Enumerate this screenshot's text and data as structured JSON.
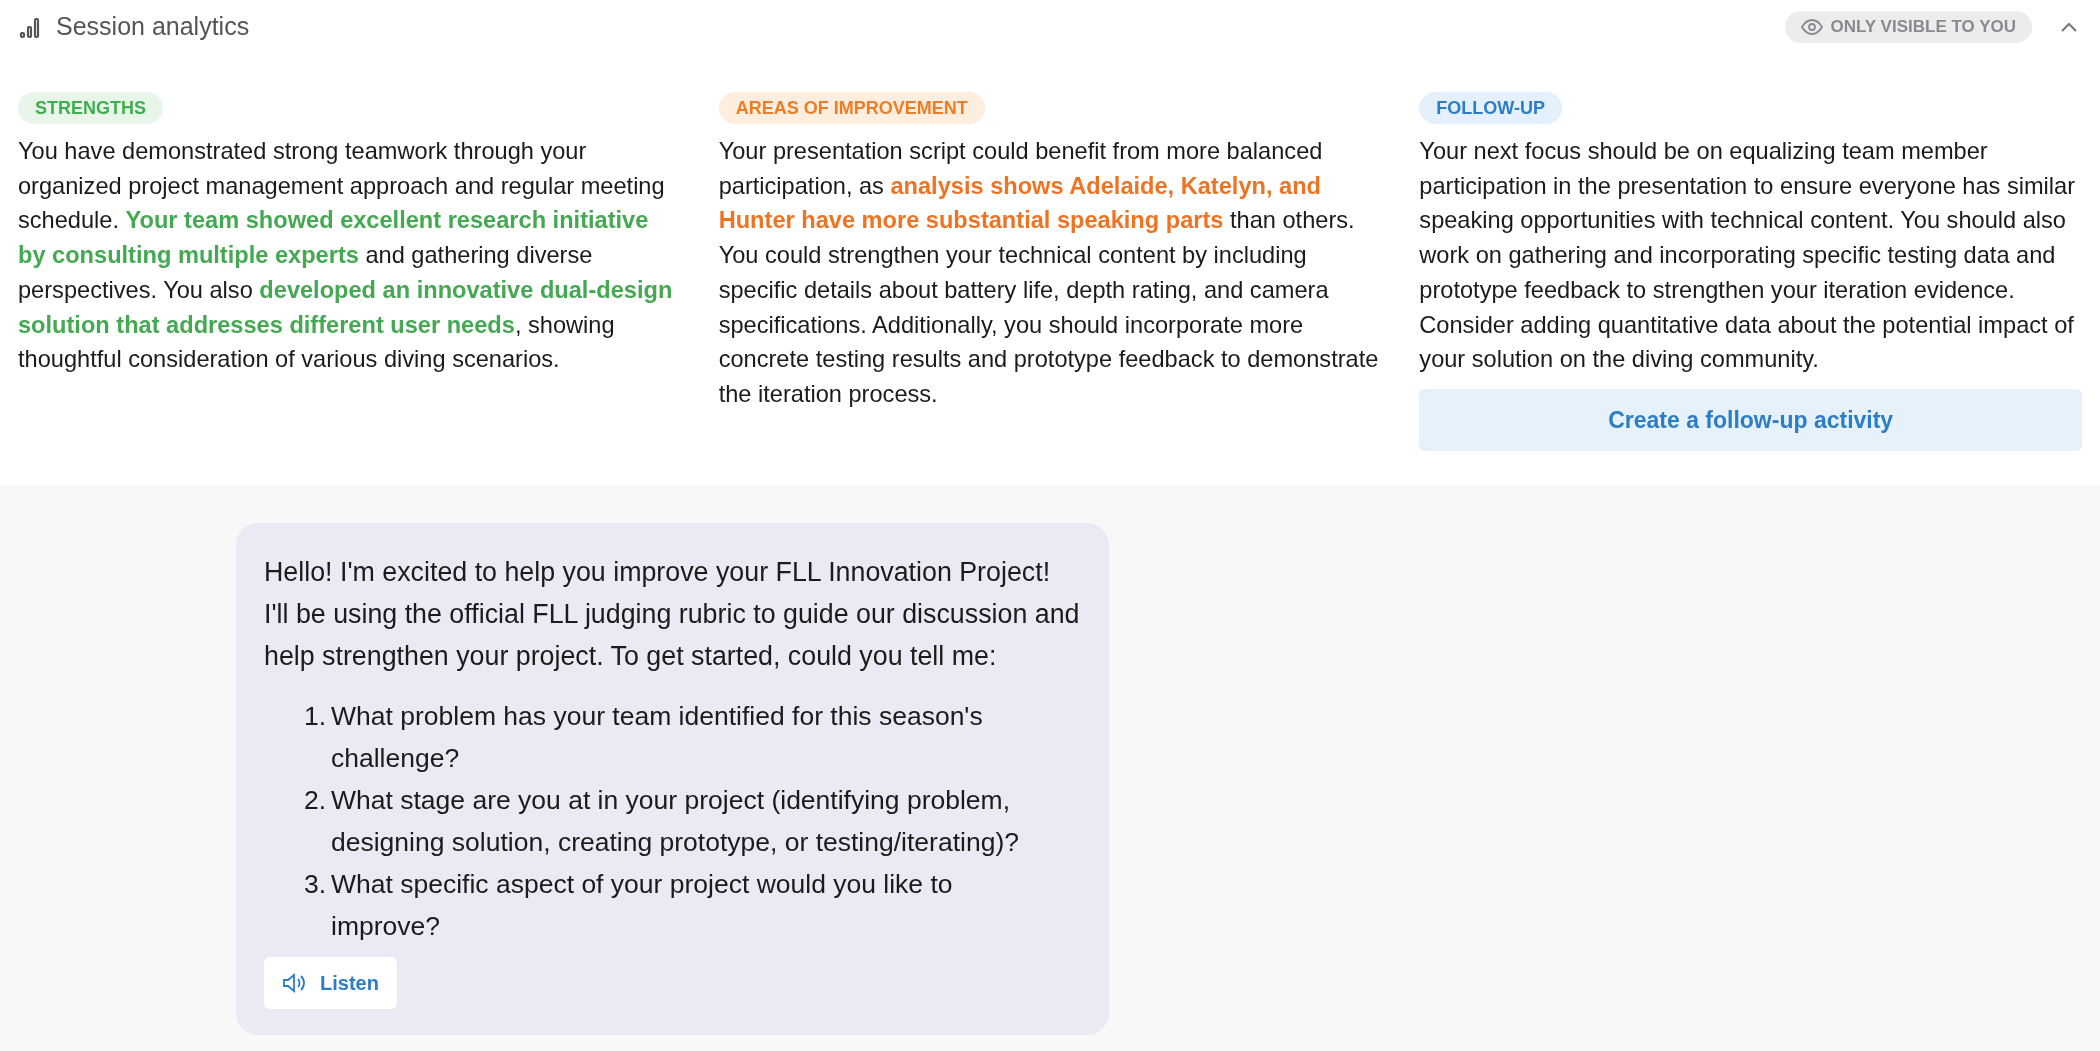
{
  "header": {
    "title": "Session analytics",
    "visibility": "ONLY VISIBLE TO YOU",
    "expanded": true
  },
  "columns": [
    {
      "kind": "strengths",
      "label": "STRENGTHS",
      "segments": [
        {
          "text": "You have demonstrated strong teamwork through your organized project management approach and regular meeting schedule. ",
          "highlight": false
        },
        {
          "text": "Your team showed excellent research initiative by consulting multiple experts",
          "highlight": true
        },
        {
          "text": " and gathering diverse perspectives. You also ",
          "highlight": false
        },
        {
          "text": "developed an innovative dual-design solution that addresses different user needs",
          "highlight": true
        },
        {
          "text": ", showing thoughtful consideration of various diving scenarios.",
          "highlight": false
        }
      ]
    },
    {
      "kind": "improvement",
      "label": "AREAS OF IMPROVEMENT",
      "segments": [
        {
          "text": "Your presentation script could benefit from more balanced participation, as ",
          "highlight": false
        },
        {
          "text": "analysis shows Adelaide, Katelyn, and Hunter have more substantial speaking parts",
          "highlight": true
        },
        {
          "text": " than others. You could strengthen your technical content by including specific details about battery life, depth rating, and camera specifications. Additionally, you should incorporate more concrete testing results and prototype feedback to demonstrate the iteration process.",
          "highlight": false
        }
      ]
    },
    {
      "kind": "followup",
      "label": "FOLLOW-UP",
      "segments": [
        {
          "text": "Your next focus should be on equalizing team member participation in the presentation to ensure everyone has similar speaking opportunities with technical content. You should also work on gathering and incorporating specific testing data and prototype feedback to strengthen your iteration evidence. Consider adding quantitative data about the potential impact of your solution on the diving community.",
          "highlight": false
        }
      ],
      "button": "Create a follow-up activity"
    }
  ],
  "message": {
    "intro": "Hello! I'm excited to help you improve your FLL Innovation Project! I'll be using the official FLL judging rubric to guide our discussion and help strengthen your project. To get started, could you tell me:",
    "questions": [
      {
        "number": "1.",
        "text": "What problem has your team identified for this season's challenge?"
      },
      {
        "number": "2.",
        "text": "What stage are you at in your project (identifying problem, designing solution, creating prototype, or testing/iterating)?"
      },
      {
        "number": "3.",
        "text": "What specific aspect of your project would you like to improve?"
      }
    ],
    "listen": "Listen"
  }
}
